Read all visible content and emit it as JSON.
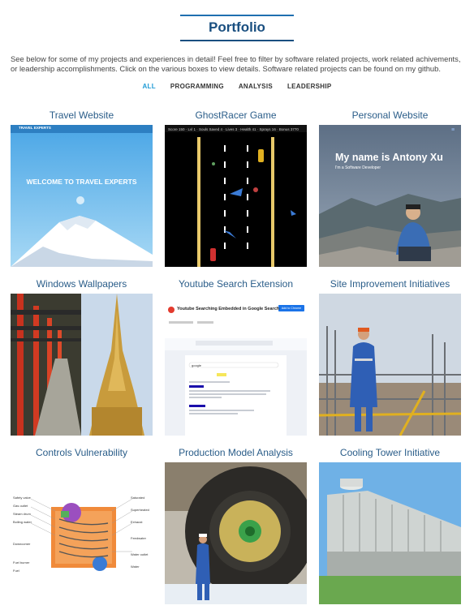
{
  "header": {
    "title": "Portfolio"
  },
  "intro": "See below for some of my projects and experiences in detail! Feel free to filter by software related projects, work related achivements, or leadership accomplishments. Click on the various boxes to view details. Software related projects can be found on my github.",
  "filters": [
    {
      "label": "ALL",
      "active": true
    },
    {
      "label": "PROGRAMMING",
      "active": false
    },
    {
      "label": "ANALYSIS",
      "active": false
    },
    {
      "label": "LEADERSHIP",
      "active": false
    }
  ],
  "cards": [
    {
      "title": "Travel Website",
      "banner": "WELCOME TO TRAVEL EXPERTS",
      "nav": "TRAVEL EXPERTS"
    },
    {
      "title": "GhostRacer Game"
    },
    {
      "title": "Personal Website",
      "headline": "My name is Antony Xu",
      "subline": "I'm a Software Developer"
    },
    {
      "title": "Windows Wallpapers"
    },
    {
      "title": "Youtube Search Extension",
      "ext_name": "Youtube Searching Embedded in Google Search",
      "button": "Add to Chrome",
      "search_query": "google"
    },
    {
      "title": "Site Improvement Initiatives"
    },
    {
      "title": "Controls Vulnerability"
    },
    {
      "title": "Production Model Analysis"
    },
    {
      "title": "Cooling Tower Initiative"
    }
  ],
  "colors": {
    "accent": "#1f9bd6",
    "title": "#1a4f80",
    "card_title": "#2a5d89"
  }
}
